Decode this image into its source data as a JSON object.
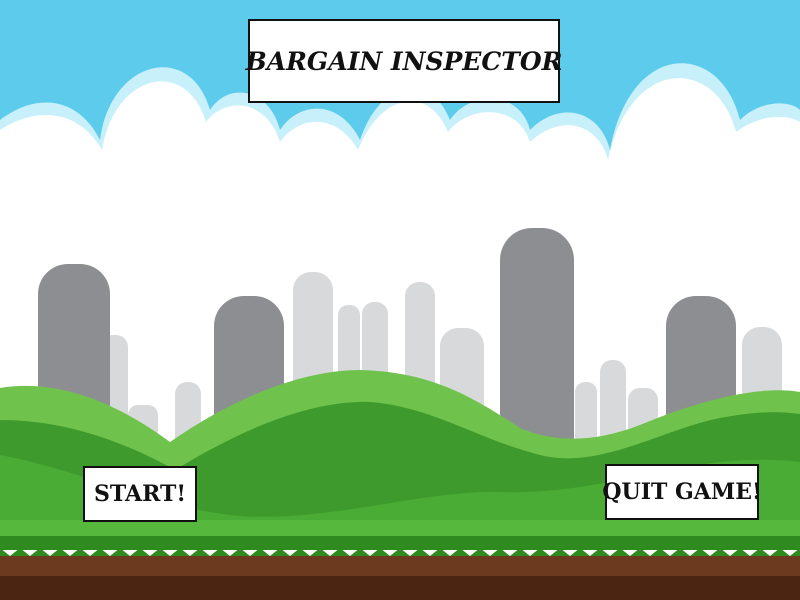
{
  "game": {
    "title": "BARGAIN INSPECTOR"
  },
  "menu": {
    "start_label": "START!",
    "quit_label": "QUIT GAME!"
  },
  "colors": {
    "sky": "#5ccbec",
    "cloud": "#ffffff",
    "cloud_outline": "#c8f0fb",
    "building_dark": "#8d8e92",
    "building_light": "#d8d9db",
    "hill_light": "#6fc34d",
    "hill_dark": "#3e9a2c",
    "grass": "#2f8a1f",
    "dirt": "#6b3a1f",
    "dirt_dark": "#4b2412"
  }
}
